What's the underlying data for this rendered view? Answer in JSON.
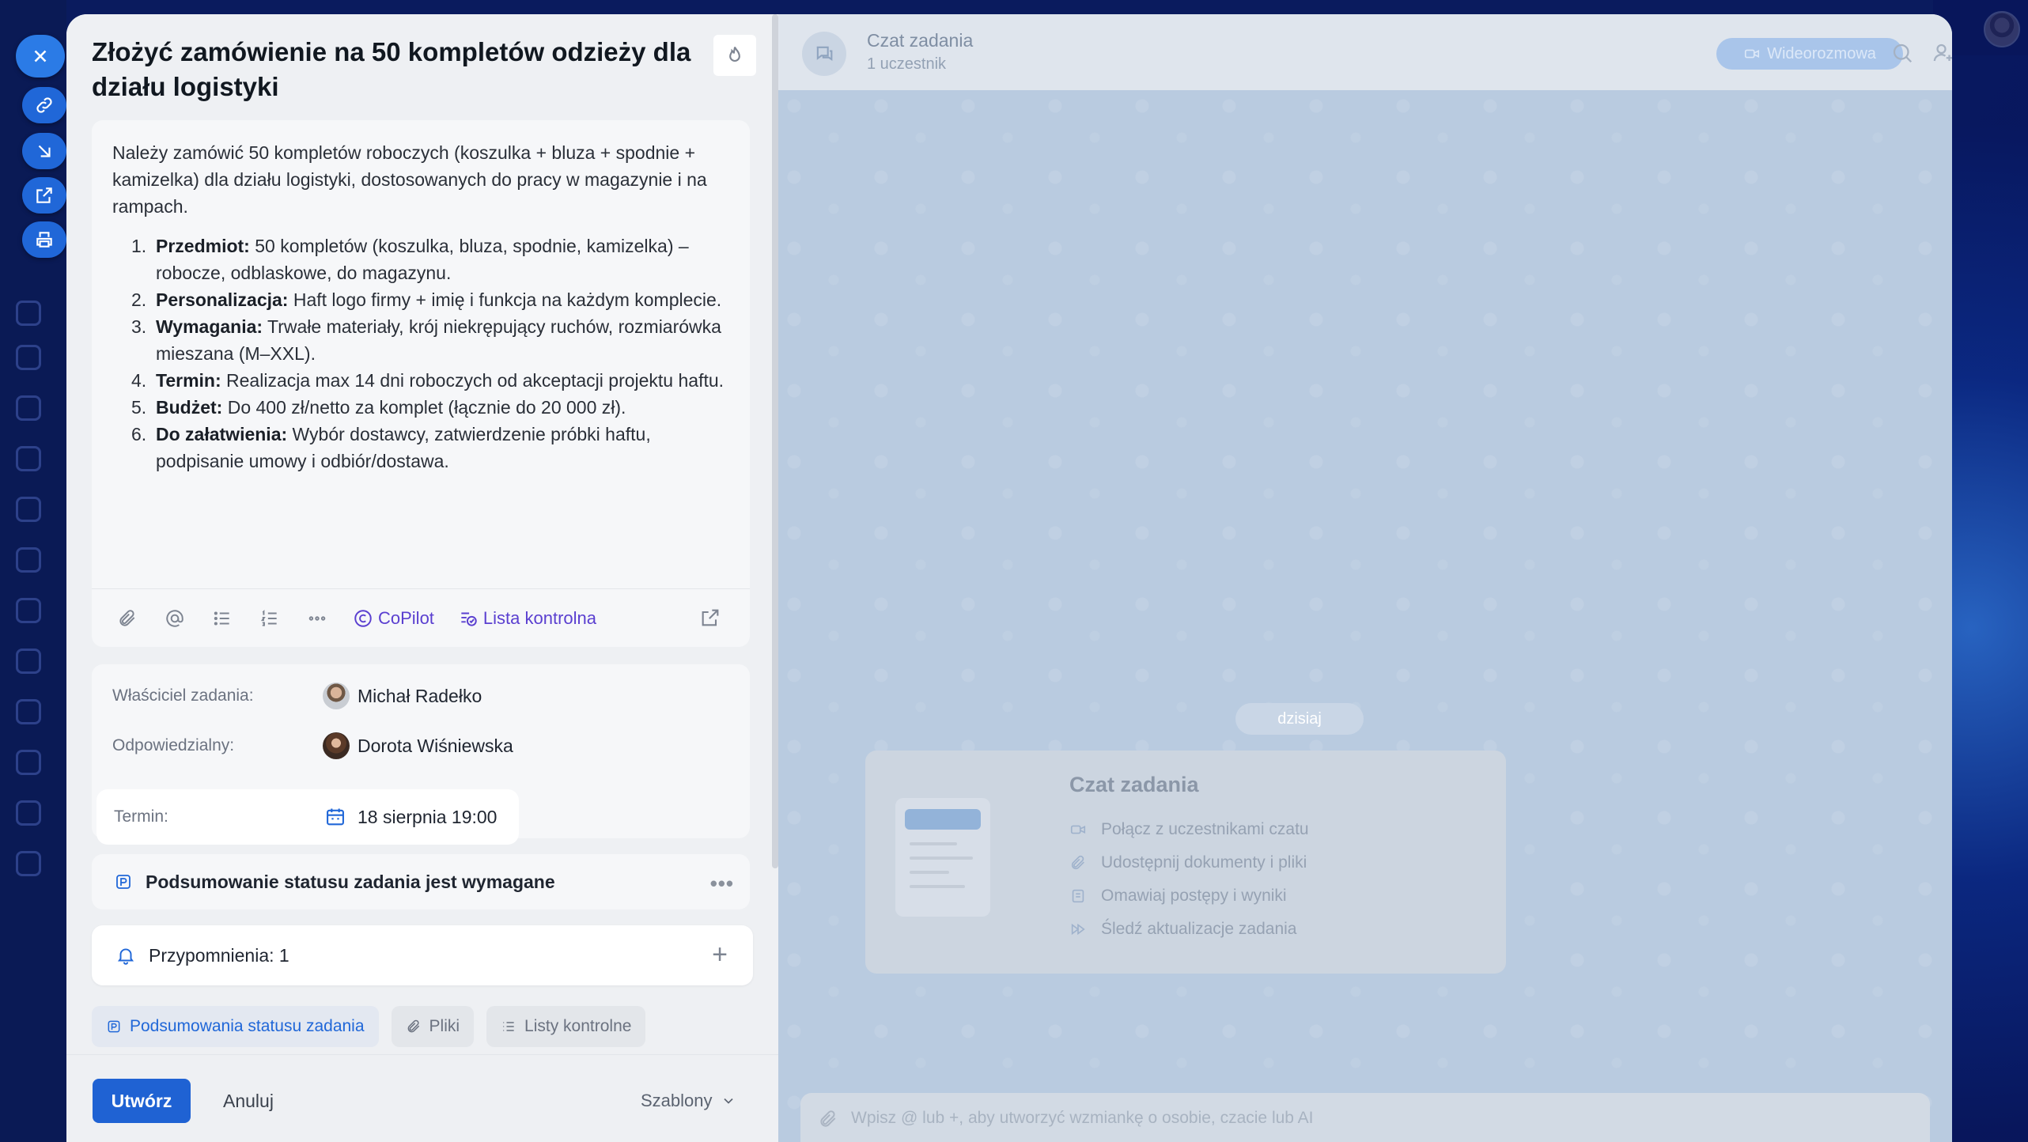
{
  "task": {
    "title": "Złożyć zamówienie na 50 kompletów odzieży dla działu logistyki",
    "description_intro": "Należy zamówić 50 kompletów roboczych (koszulka + bluza + spodnie + kamizelka) dla działu logistyki, dostosowanych do pracy w magazynie i na rampach.",
    "items": [
      {
        "num": "1.",
        "label": "Przedmiot:",
        "text": " 50 kompletów (koszulka, bluza, spodnie, kamizelka) – robocze, odblaskowe, do magazynu."
      },
      {
        "num": "2.",
        "label": "Personalizacja:",
        "text": " Haft logo firmy + imię i funkcja na każdym komplecie."
      },
      {
        "num": "3.",
        "label": "Wymagania:",
        "text": " Trwałe materiały, krój niekrępujący ruchów, rozmiarówka mieszana (M–XXL)."
      },
      {
        "num": "4.",
        "label": "Termin:",
        "text": " Realizacja max 14 dni roboczych od akceptacji projektu haftu."
      },
      {
        "num": "5.",
        "label": "Budżet:",
        "text": " Do 400 zł/netto za komplet (łącznie do 20 000 zł)."
      },
      {
        "num": "6.",
        "label": "Do załatwienia:",
        "text": " Wybór dostawcy, zatwierdzenie próbki haftu, podpisanie umowy i odbiór/dostawa."
      }
    ]
  },
  "toolbar": {
    "copilot_label": "CoPilot",
    "checklist_label": "Lista kontrolna"
  },
  "people": {
    "owner_label": "Właściciel zadania:",
    "owner_name": "Michał Radełko",
    "assignee_label": "Odpowiedzialny:",
    "assignee_name": "Dorota Wiśniewska",
    "deadline_label": "Termin:",
    "deadline_value": "18 sierpnia 19:00"
  },
  "status_summary": {
    "label": "Podsumowanie statusu zadania jest wymagane"
  },
  "reminders": {
    "label": "Przypomnienia: 1"
  },
  "chips": [
    {
      "label": "Podsumowania statusu zadania"
    },
    {
      "label": "Pliki"
    },
    {
      "label": "Listy kontrolne"
    }
  ],
  "footer": {
    "create_label": "Utwórz",
    "cancel_label": "Anuluj",
    "templates_label": "Szablony"
  },
  "chat": {
    "title": "Czat zadania",
    "subtitle": "1 uczestnik",
    "video_label": "Wideorozmowa",
    "date_pill": "dzisiaj",
    "intro_title": "Czat zadania",
    "intro_items": [
      "Połącz z uczestnikami czatu",
      "Udostępnij dokumenty i pliki",
      "Omawiaj postępy i wyniki",
      "Śledź aktualizacje zadania"
    ],
    "composer_placeholder": "Wpisz @ lub +, aby utworzyć wzmiankę o osobie, czacie lub AI"
  },
  "colors": {
    "accent": "#1f62d3",
    "copilot": "#5a3fd0",
    "chat_bg": "#b9cbe0"
  }
}
